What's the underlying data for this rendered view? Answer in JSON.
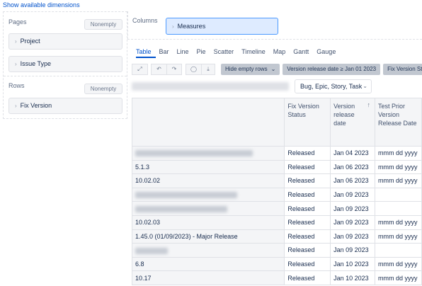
{
  "top_link": "Show available dimensions",
  "pages": {
    "label": "Pages",
    "nonempty": "Nonempty",
    "items": [
      {
        "label": "Project"
      },
      {
        "label": "Issue Type"
      }
    ]
  },
  "rows": {
    "label": "Rows",
    "nonempty": "Nonempty",
    "items": [
      {
        "label": "Fix Version"
      }
    ]
  },
  "columns": {
    "label": "Columns",
    "measures": "Measures"
  },
  "tabs": [
    "Table",
    "Bar",
    "Line",
    "Pie",
    "Scatter",
    "Timeline",
    "Map",
    "Gantt",
    "Gauge"
  ],
  "toolbar": {
    "hide_empty": "Hide empty rows",
    "filter1": "Version release date ≥ Jan 01 2023",
    "filter2": "Fix Version Stat"
  },
  "issue_type_select": "Bug, Epic, Story, Task",
  "table": {
    "headers": [
      "Fix Version Status",
      "Version release date",
      "Test Prior Version Release Date"
    ],
    "rows": [
      {
        "name": "",
        "status": "Released",
        "date": "Jan 04 2023",
        "prior": "mmm dd yyyy"
      },
      {
        "name": "5.1.3",
        "status": "Released",
        "date": "Jan 06 2023",
        "prior": "mmm dd yyyy"
      },
      {
        "name": "10.02.02",
        "status": "Released",
        "date": "Jan 06 2023",
        "prior": "mmm dd yyyy"
      },
      {
        "name": "",
        "status": "Released",
        "date": "Jan 09 2023",
        "prior": ""
      },
      {
        "name": "",
        "status": "Released",
        "date": "Jan 09 2023",
        "prior": ""
      },
      {
        "name": "10.02.03",
        "status": "Released",
        "date": "Jan 09 2023",
        "prior": "mmm dd yyyy"
      },
      {
        "name": "1.45.0 (01/09/2023) - Major Release",
        "status": "Released",
        "date": "Jan 09 2023",
        "prior": "mmm dd yyyy"
      },
      {
        "name": "",
        "status": "Released",
        "date": "Jan 09 2023",
        "prior": ""
      },
      {
        "name": "6.8",
        "status": "Released",
        "date": "Jan 10 2023",
        "prior": "mmm dd yyyy"
      },
      {
        "name": "10.17",
        "status": "Released",
        "date": "Jan 10 2023",
        "prior": "mmm dd yyyy"
      }
    ]
  }
}
